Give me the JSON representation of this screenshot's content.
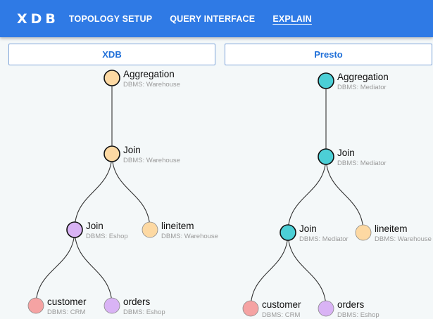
{
  "app": {
    "brand": "XDB",
    "nav": [
      {
        "label": "TOPOLOGY SETUP",
        "active": false
      },
      {
        "label": "QUERY INTERFACE",
        "active": false
      },
      {
        "label": "EXPLAIN",
        "active": true
      }
    ]
  },
  "panels": [
    {
      "title": "XDB",
      "nodes": [
        {
          "id": "agg",
          "label": "Aggregation",
          "dbms": "DBMS: Warehouse",
          "color": "#fdd9a3"
        },
        {
          "id": "join1",
          "label": "Join",
          "dbms": "DBMS: Warehouse",
          "color": "#fdd9a3"
        },
        {
          "id": "join2",
          "label": "Join",
          "dbms": "DBMS: Eshop",
          "color": "#d9b3f5"
        },
        {
          "id": "lineitem",
          "label": "lineitem",
          "dbms": "DBMS: Warehouse",
          "color": "#fdd9a3"
        },
        {
          "id": "customer",
          "label": "customer",
          "dbms": "DBMS: CRM",
          "color": "#f5a3a3"
        },
        {
          "id": "orders",
          "label": "orders",
          "dbms": "DBMS: Eshop",
          "color": "#d9b3f5"
        }
      ]
    },
    {
      "title": "Presto",
      "nodes": [
        {
          "id": "agg",
          "label": "Aggregation",
          "dbms": "DBMS: Mediator",
          "color": "#4ccfd6"
        },
        {
          "id": "join1",
          "label": "Join",
          "dbms": "DBMS: Mediator",
          "color": "#4ccfd6"
        },
        {
          "id": "join2",
          "label": "Join",
          "dbms": "DBMS: Mediator",
          "color": "#4ccfd6"
        },
        {
          "id": "lineitem",
          "label": "lineitem",
          "dbms": "DBMS: Warehouse",
          "color": "#fdd9a3"
        },
        {
          "id": "customer",
          "label": "customer",
          "dbms": "DBMS: CRM",
          "color": "#f5a3a3"
        },
        {
          "id": "orders",
          "label": "orders",
          "dbms": "DBMS: Eshop",
          "color": "#d9b3f5"
        }
      ]
    }
  ],
  "highlighted_nodes": [
    "agg",
    "join1",
    "join2"
  ]
}
